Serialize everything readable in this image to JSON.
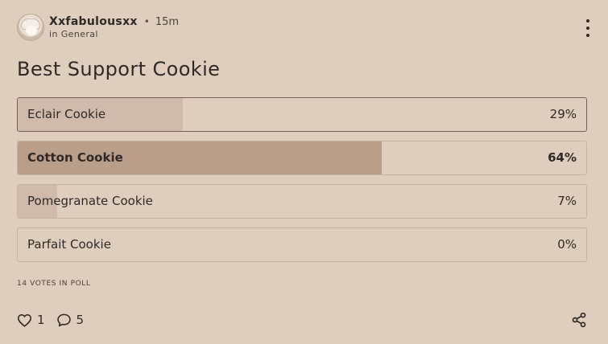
{
  "post": {
    "username": "Xxfabulousxx",
    "separator": "•",
    "time": "15m",
    "community": "in General",
    "title": "Best Support Cookie"
  },
  "poll": {
    "options": [
      {
        "label": "Eclair Cookie",
        "percent_text": "29%",
        "percent": 29,
        "selected": true,
        "winner": false
      },
      {
        "label": "Cotton Cookie",
        "percent_text": "64%",
        "percent": 64,
        "selected": false,
        "winner": true
      },
      {
        "label": "Pomegranate Cookie",
        "percent_text": "7%",
        "percent": 7,
        "selected": false,
        "winner": false
      },
      {
        "label": "Parfait Cookie",
        "percent_text": "0%",
        "percent": 0,
        "selected": false,
        "winner": false
      }
    ],
    "votes_text": "14 votes in poll"
  },
  "footer": {
    "likes": "1",
    "comments": "5"
  },
  "icons": {
    "menu": "more-vertical-icon",
    "like": "heart-icon",
    "comment": "comment-icon",
    "share": "share-icon"
  },
  "colors": {
    "background": "#dfcdbd",
    "fill": "#cfbaab",
    "winner_fill": "#b99f8a",
    "selected_border": "#7b5f55"
  }
}
